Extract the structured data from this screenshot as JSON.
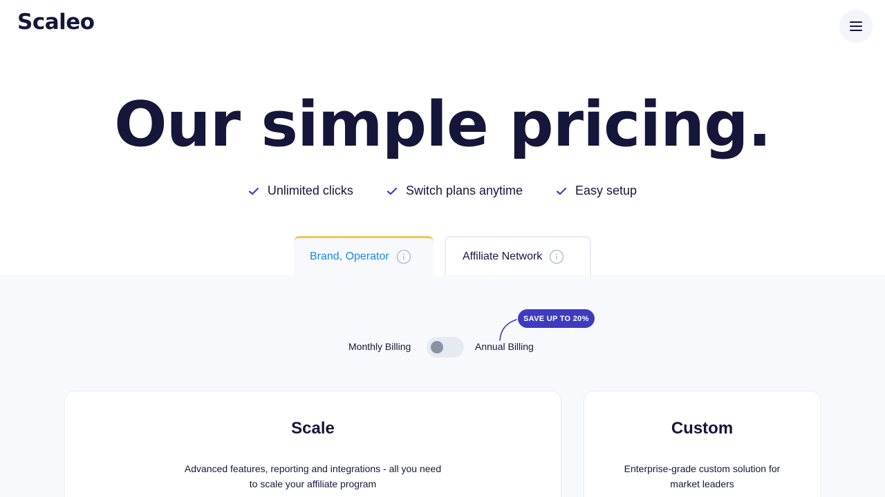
{
  "header": {
    "logo": "Scaleo",
    "menu_icon": "hamburger-menu-icon"
  },
  "hero": {
    "title": "Our simple pricing."
  },
  "features": [
    {
      "icon": "check-icon",
      "label": "Unlimited clicks"
    },
    {
      "icon": "check-icon",
      "label": "Switch plans anytime"
    },
    {
      "icon": "check-icon",
      "label": "Easy setup"
    }
  ],
  "tabs": [
    {
      "label": "Brand, Operator",
      "icon": "info-icon",
      "active": true
    },
    {
      "label": "Affiliate Network",
      "icon": "info-icon",
      "active": false
    }
  ],
  "billing": {
    "monthly_label": "Monthly Billing",
    "annual_label": "Annual Billing",
    "badge": "SAVE UP TO 20%",
    "toggle_state": "monthly"
  },
  "plans": [
    {
      "name": "Scale",
      "description": "Advanced features, reporting and integrations -  all you need to scale your affiliate program"
    },
    {
      "name": "Custom",
      "description": "Enterprise-grade custom solution for market leaders"
    }
  ],
  "colors": {
    "brand_dark": "#15163a",
    "accent_blue": "#1a8ae6",
    "badge_purple": "#3e3bbf",
    "tab_highlight": "#f3c352",
    "check": "#3e3bbf"
  }
}
